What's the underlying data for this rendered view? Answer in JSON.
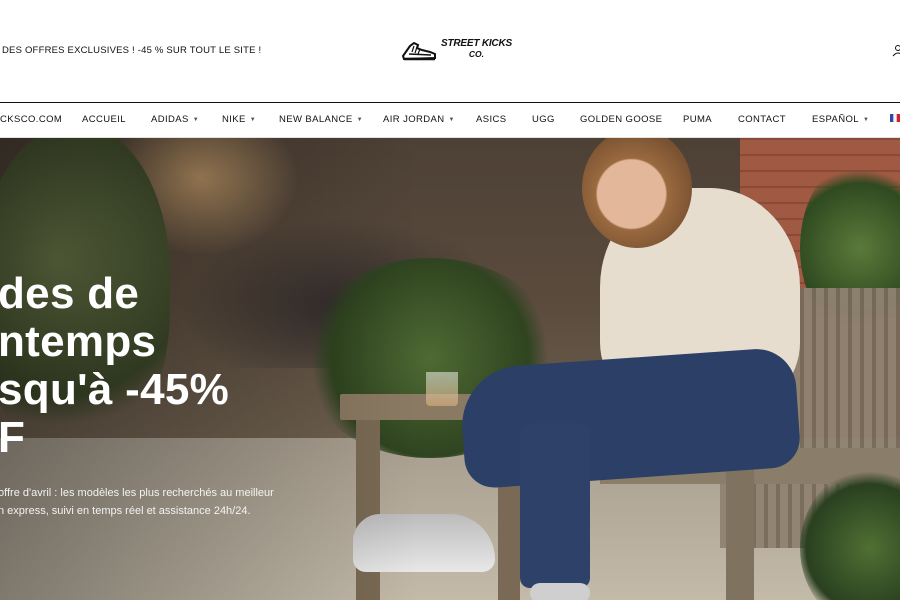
{
  "header": {
    "promo": "DES OFFRES EXCLUSIVES ! -45 % SUR TOUT LE SITE !",
    "logo_line1": "STREET KICKS",
    "logo_line2": "CO."
  },
  "nav": {
    "items": [
      {
        "label": "CKSCO.COM",
        "dropdown": false
      },
      {
        "label": "ACCUEIL",
        "dropdown": false
      },
      {
        "label": "ADIDAS",
        "dropdown": true
      },
      {
        "label": "NIKE",
        "dropdown": true
      },
      {
        "label": "NEW BALANCE",
        "dropdown": true
      },
      {
        "label": "AIR JORDAN",
        "dropdown": true
      },
      {
        "label": "ASICS",
        "dropdown": false
      },
      {
        "label": "UGG",
        "dropdown": false
      },
      {
        "label": "GOLDEN GOOSE",
        "dropdown": false
      },
      {
        "label": "PUMA",
        "dropdown": false
      },
      {
        "label": "CONTACT",
        "dropdown": false
      },
      {
        "label": "ESPAÑOL",
        "dropdown": true
      }
    ]
  },
  "hero": {
    "title_lines": [
      "des de",
      "ntemps",
      "squ'à -45%",
      "F"
    ],
    "subtitle_lines": [
      "offre d'avril : les modèles les plus recherchés au meilleur",
      "n express, suivi en temps réel et assistance 24h/24."
    ]
  },
  "colors": {
    "text": "#111111",
    "hero_text": "#ffffff",
    "nav_border": "#111111"
  }
}
